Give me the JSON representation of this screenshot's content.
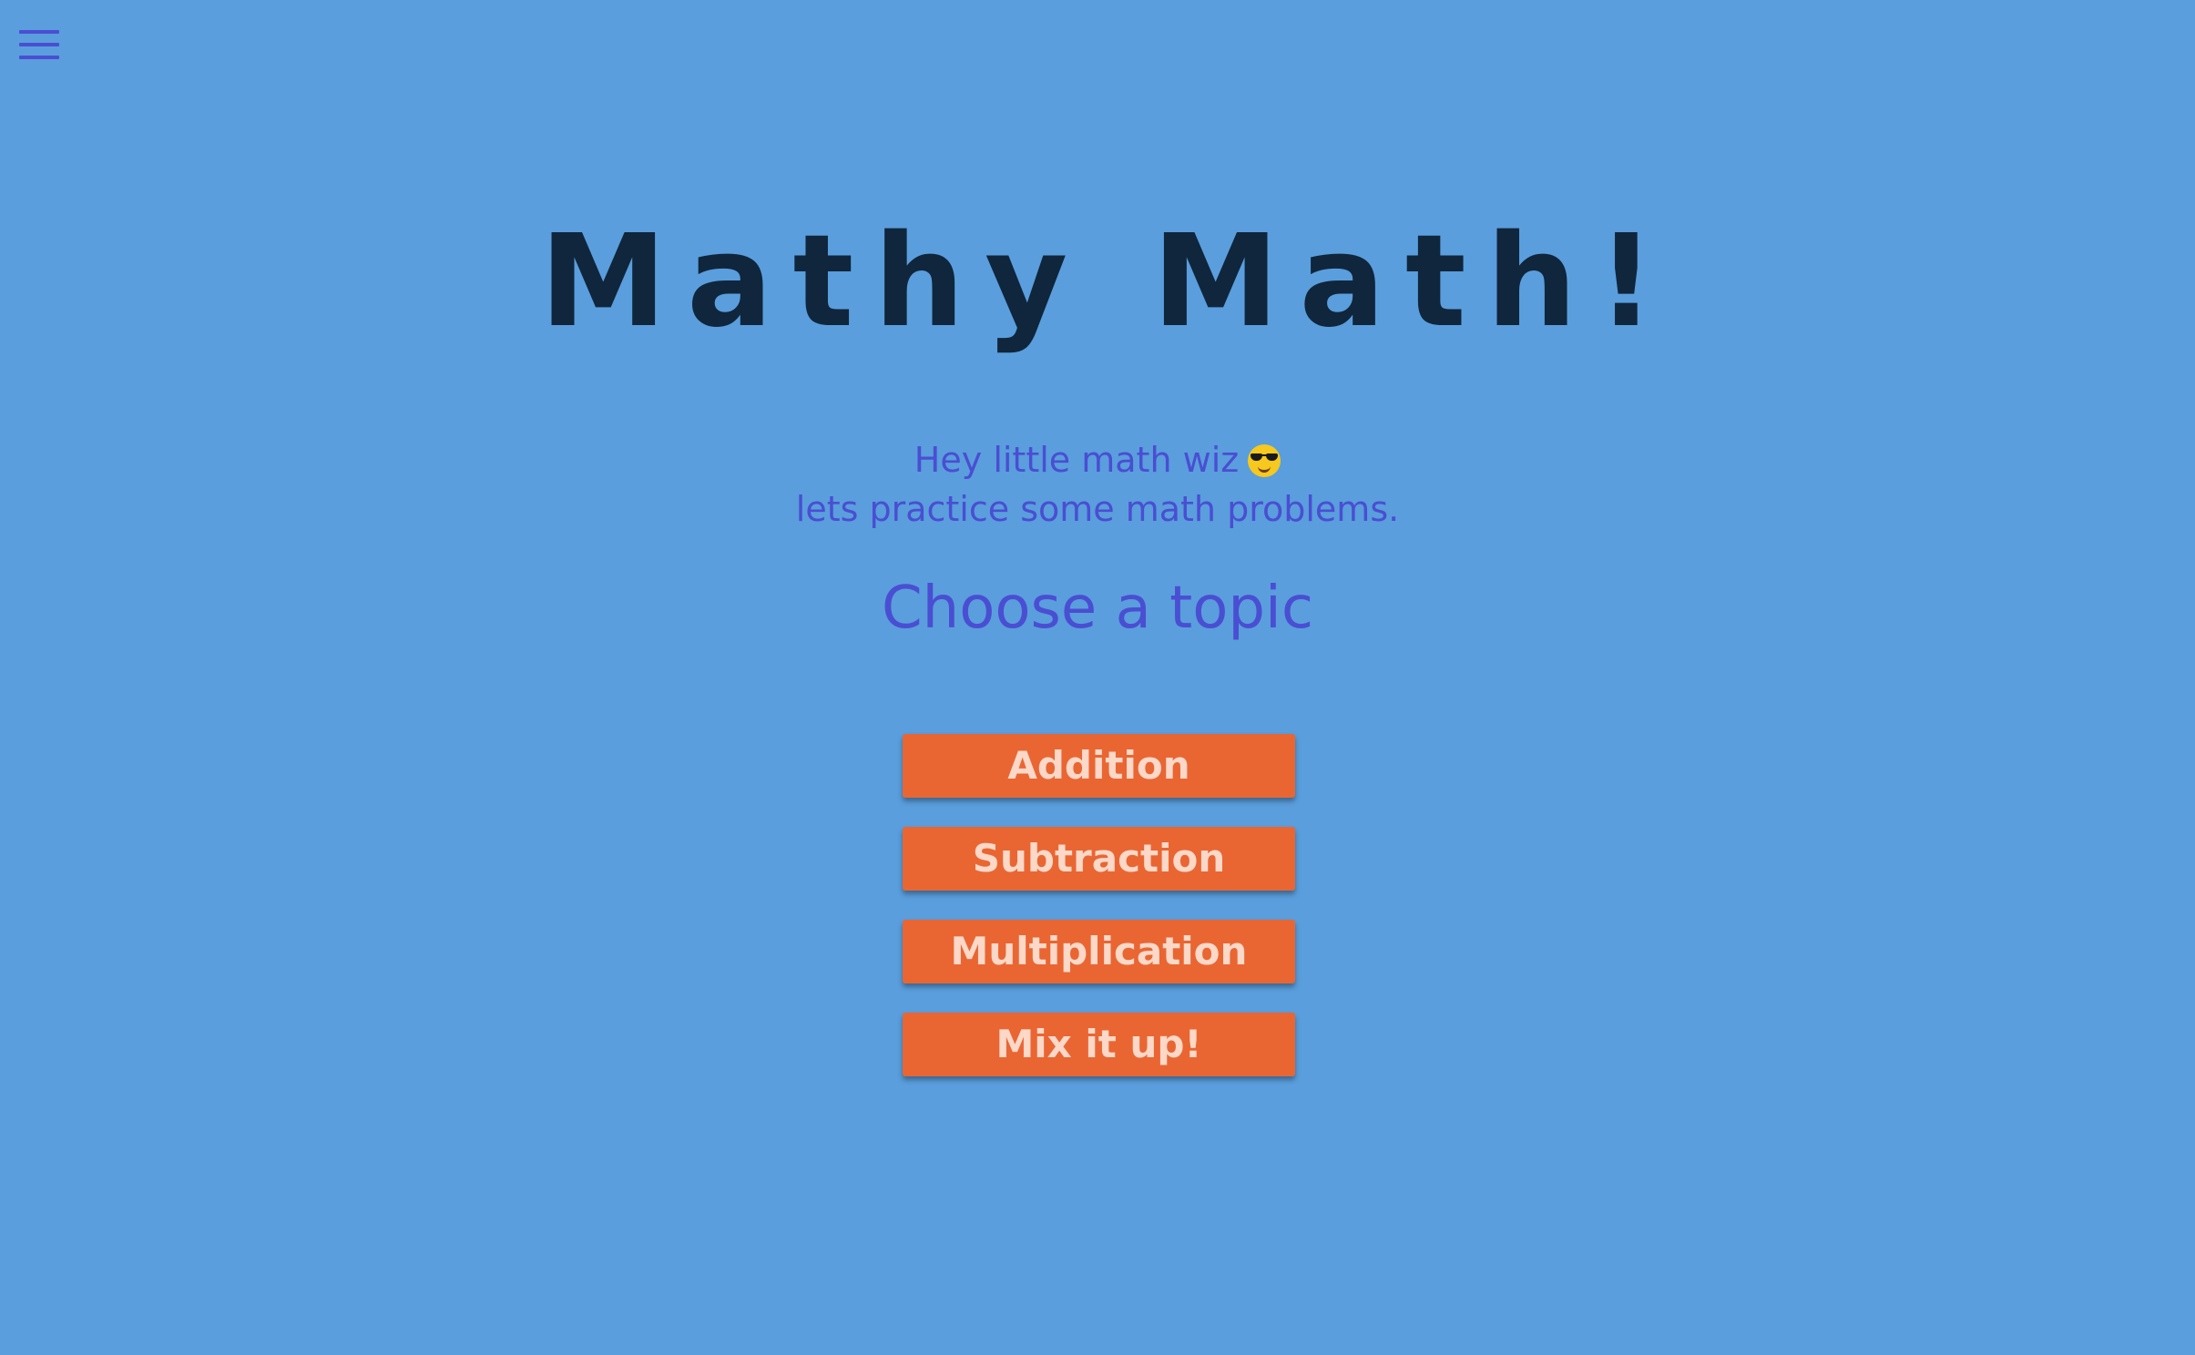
{
  "nav": {
    "menu_icon": "hamburger-menu-icon"
  },
  "main": {
    "title": "Mathy Math!",
    "intro_line1": "Hey little math wiz",
    "intro_emoji": "smiling-face-with-sunglasses-emoji",
    "intro_line2": "lets practice some math problems.",
    "subtitle": "Choose a topic"
  },
  "topics": [
    {
      "label": "Addition"
    },
    {
      "label": "Subtraction"
    },
    {
      "label": "Multiplication"
    },
    {
      "label": "Mix it up!"
    }
  ],
  "colors": {
    "background": "#5a9edd",
    "title": "#10263c",
    "accent_text": "#4a4ed2",
    "button_bg": "#e96633",
    "button_text": "#fbd8c8"
  }
}
